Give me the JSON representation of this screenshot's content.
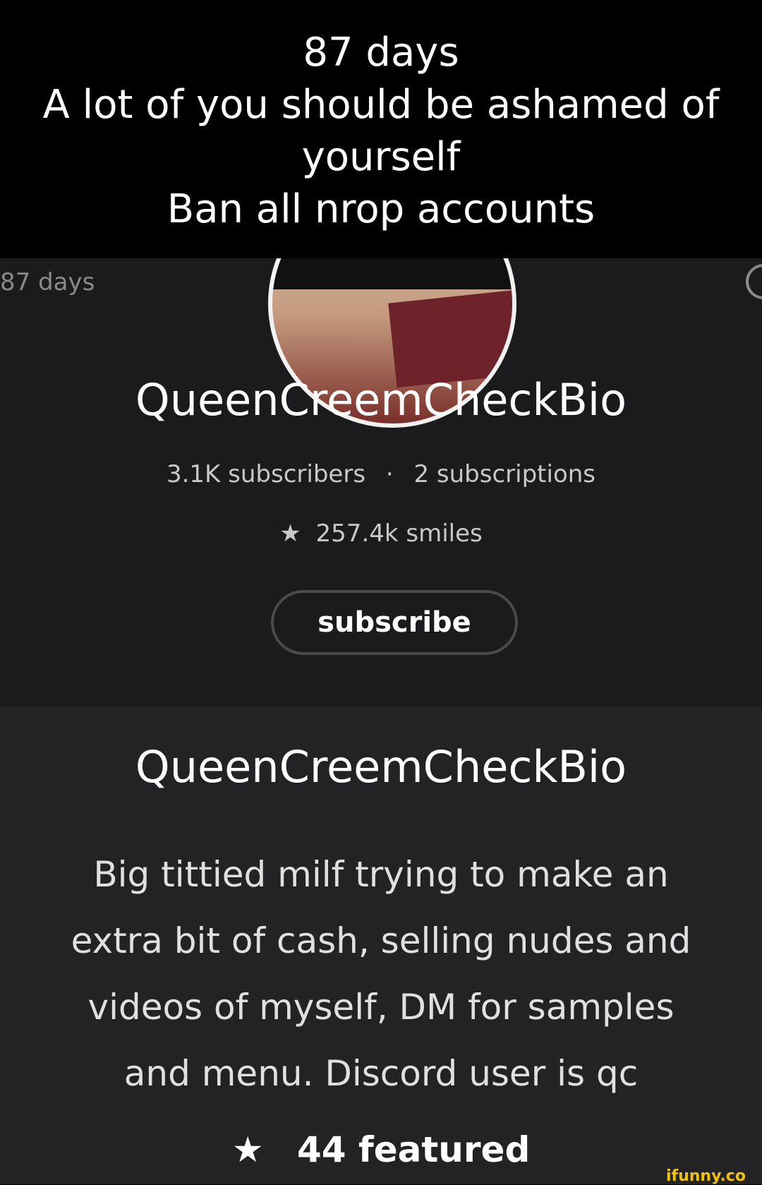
{
  "caption": {
    "lines": [
      "87 days",
      "A lot of you should be ashamed of",
      "yourself",
      "Ban all nrop accounts"
    ]
  },
  "profile": {
    "age": "87 days",
    "username": "QueenCreemCheckBio",
    "subscribers": "3.1K subscribers",
    "separator": "·",
    "subscriptions": "2 subscriptions",
    "smiles_icon": "★",
    "smiles": "257.4k smiles",
    "subscribe_label": "subscribe"
  },
  "bio": {
    "name": "QueenCreemCheckBio",
    "lines": [
      "Big tittied milf trying to make an",
      "extra bit of cash, selling nudes and",
      "videos of myself, DM for samples",
      "and menu. Discord user is qc"
    ],
    "featured_icon": "★",
    "featured": "44 featured"
  },
  "watermark": "ifunny.co"
}
